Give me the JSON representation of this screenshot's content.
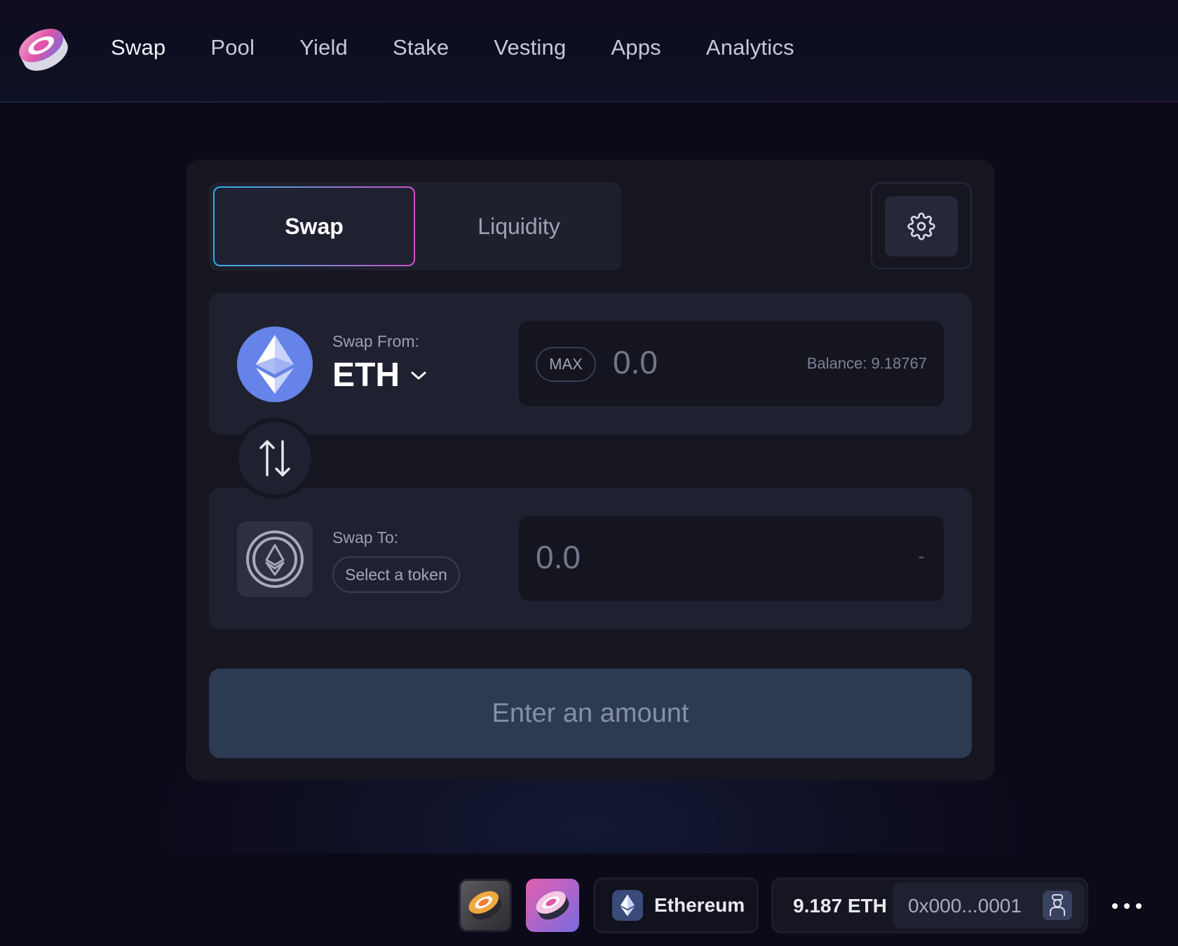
{
  "header": {
    "nav": [
      "Swap",
      "Pool",
      "Yield",
      "Stake",
      "Vesting",
      "Apps",
      "Analytics"
    ],
    "active": "Swap"
  },
  "swap_card": {
    "tabs": {
      "swap": "Swap",
      "liquidity": "Liquidity"
    },
    "from": {
      "label": "Swap From:",
      "token": "ETH",
      "max_label": "MAX",
      "amount_placeholder": "0.0",
      "balance": "Balance: 9.18767"
    },
    "to": {
      "label": "Swap To:",
      "select_label": "Select a token",
      "amount_placeholder": "0.0",
      "balance": "-"
    },
    "cta": "Enter an amount"
  },
  "bottom_bar": {
    "network": "Ethereum",
    "eth_balance": "9.187 ETH",
    "address": "0x000...0001"
  },
  "colors": {
    "background": "#0c0a19",
    "card": "#161621",
    "panel": "#1f2130",
    "eth_blue": "#6583e8",
    "tab_gradient_start": "#2ab3e8",
    "tab_gradient_end": "#d052c9",
    "cta_bg": "#2c3a52"
  },
  "icons": [
    "sushi-logo-icon",
    "gear-icon",
    "eth-icon",
    "chevron-down-icon",
    "swap-arrows-icon",
    "eth-outline-icon",
    "chef-avatar-icon",
    "more-icon"
  ]
}
